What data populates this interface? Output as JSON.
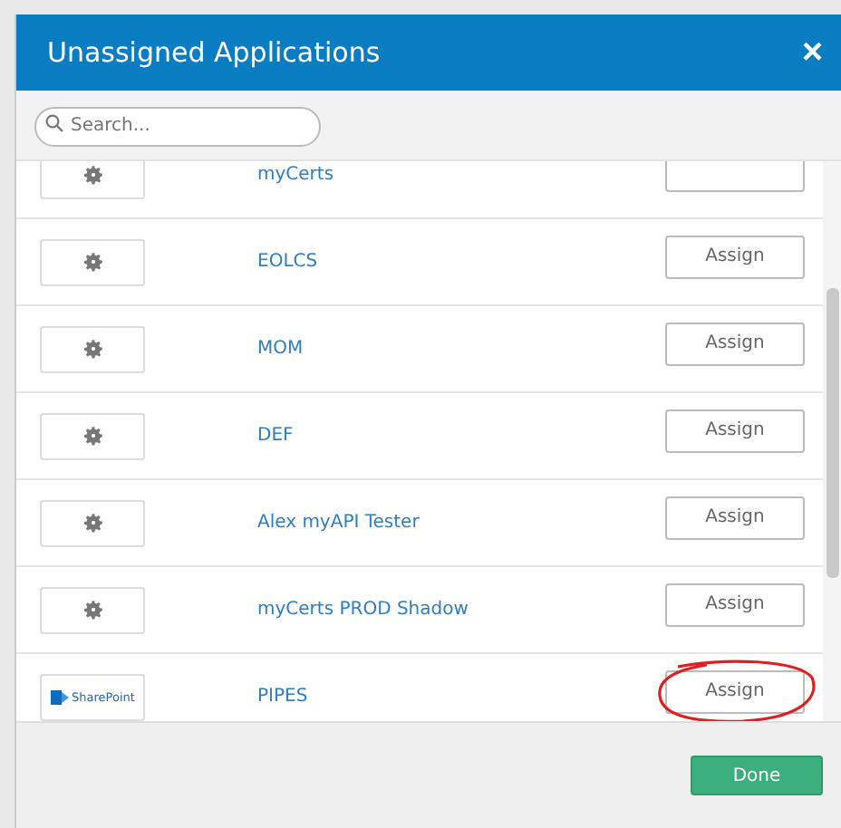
{
  "dialog": {
    "title": "Unassigned Applications",
    "close": "×"
  },
  "search": {
    "placeholder": "Search..."
  },
  "rows": [
    {
      "logo": {
        "kind": "gear"
      },
      "name": "myCerts",
      "button": "",
      "circled": false
    },
    {
      "logo": {
        "kind": "gear"
      },
      "name": "EOLCS",
      "button": "Assign",
      "circled": false
    },
    {
      "logo": {
        "kind": "gear"
      },
      "name": "MOM",
      "button": "Assign",
      "circled": false
    },
    {
      "logo": {
        "kind": "gear"
      },
      "name": "DEF",
      "button": "Assign",
      "circled": false
    },
    {
      "logo": {
        "kind": "gear"
      },
      "name": "Alex myAPI Tester",
      "button": "Assign",
      "circled": false
    },
    {
      "logo": {
        "kind": "gear"
      },
      "name": "myCerts PROD Shadow",
      "button": "Assign",
      "circled": false
    },
    {
      "logo": {
        "kind": "sharepoint",
        "text": "SharePoint"
      },
      "name": "PIPES",
      "button": "Assign",
      "circled": true
    }
  ],
  "footer": {
    "button": "Done"
  }
}
